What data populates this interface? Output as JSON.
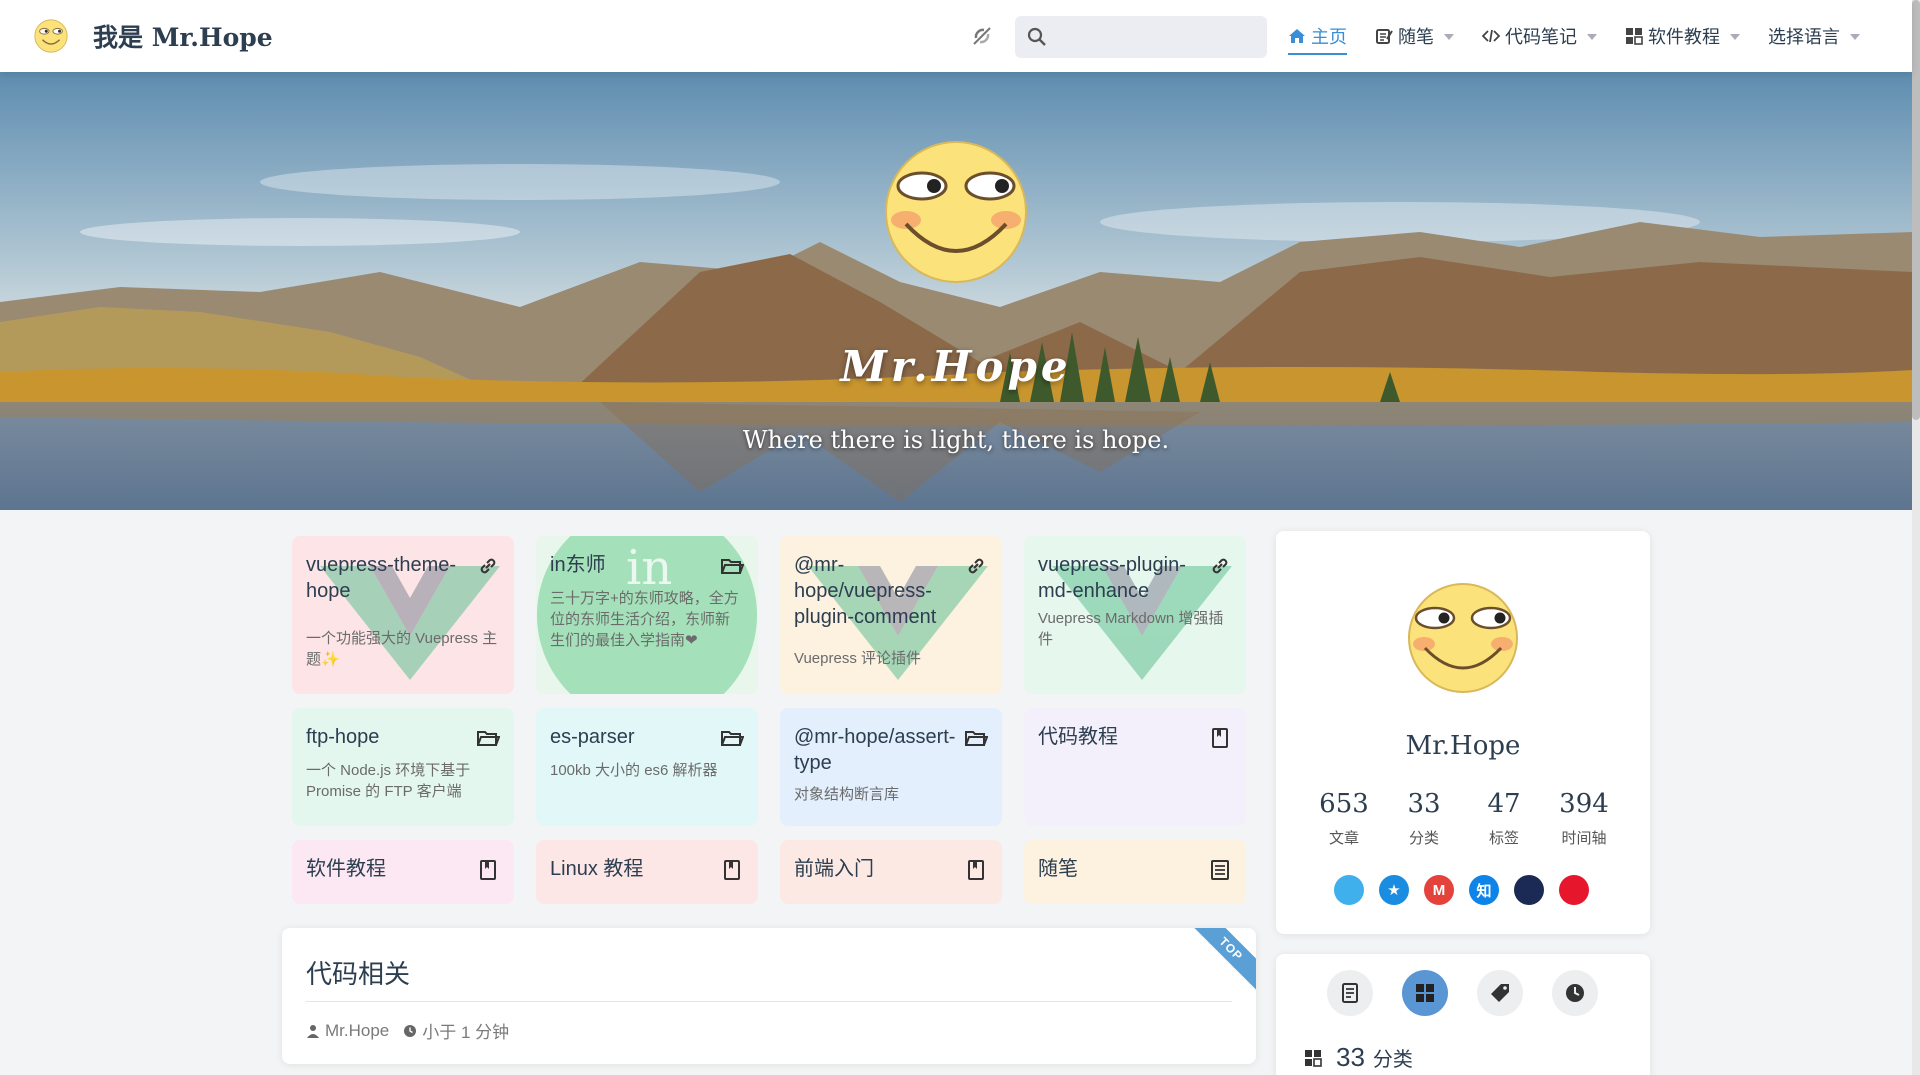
{
  "navbar": {
    "title": "我是 Mr.Hope",
    "search": {
      "value": "",
      "placeholder": ""
    },
    "items": [
      {
        "label": "主页",
        "icon": "home-icon",
        "active": true,
        "dropdown": false
      },
      {
        "label": "随笔",
        "icon": "notes-icon",
        "active": false,
        "dropdown": true
      },
      {
        "label": "代码笔记",
        "icon": "code-icon",
        "active": false,
        "dropdown": true
      },
      {
        "label": "软件教程",
        "icon": "grid-icon",
        "active": false,
        "dropdown": true
      },
      {
        "label": "选择语言",
        "icon": "",
        "active": false,
        "dropdown": true
      }
    ]
  },
  "hero": {
    "title": "Mr.Hope",
    "tagline": "Where there is light, there is hope."
  },
  "projects": [
    {
      "title": "vuepress-theme-hope",
      "desc": "一个功能强大的 Vuepress 主题✨",
      "icon": "link-icon",
      "bg": "#fde4e6",
      "vue": true
    },
    {
      "title": "in东师",
      "desc": "三十万字+的东师攻略，全方位的东师生活介绍，东师新生们的最佳入学指南❤",
      "icon": "folder-icon",
      "bg": "#e8f6ec",
      "indong": true
    },
    {
      "title": "@mr-hope/vuepress-plugin-comment",
      "desc": "Vuepress 评论插件",
      "icon": "link-icon",
      "bg": "#fdf1e0",
      "vue": true
    },
    {
      "title": "vuepress-plugin-md-enhance",
      "desc": "Vuepress Markdown 增强插件",
      "icon": "link-icon",
      "bg": "#e6f7ed",
      "vue": true
    },
    {
      "title": "ftp-hope",
      "desc": "一个 Node.js 环境下基于 Promise 的 FTP 客户端",
      "icon": "folder-icon",
      "bg": "#e4f7ee"
    },
    {
      "title": "es-parser",
      "desc": "100kb 大小的 es6 解析器",
      "icon": "folder-icon",
      "bg": "#e2f8f8"
    },
    {
      "title": "@mr-hope/assert-type",
      "desc": "对象结构断言库",
      "icon": "folder-icon",
      "bg": "#e3effc"
    },
    {
      "title": "代码教程",
      "desc": "",
      "icon": "book-icon",
      "bg": "#f4f0fb"
    },
    {
      "title": "软件教程",
      "desc": "",
      "icon": "book-icon",
      "bg": "#fbe8f2"
    },
    {
      "title": "Linux 教程",
      "desc": "",
      "icon": "book-icon",
      "bg": "#fde6e6"
    },
    {
      "title": "前端入门",
      "desc": "",
      "icon": "book-icon",
      "bg": "#fde9e4"
    },
    {
      "title": "随笔",
      "desc": "",
      "icon": "article-icon",
      "bg": "#fdf1e0"
    }
  ],
  "article": {
    "title": "代码相关",
    "badge": "TOP",
    "author": "Mr.Hope",
    "reading_time": "小于 1 分钟"
  },
  "profile": {
    "name": "Mr.Hope",
    "stats": [
      {
        "num": "653",
        "label": "文章"
      },
      {
        "num": "33",
        "label": "分类"
      },
      {
        "num": "47",
        "label": "标签"
      },
      {
        "num": "394",
        "label": "时间轴"
      }
    ],
    "socials": [
      {
        "name": "qq-icon",
        "color": "#3fb0ec",
        "glyph": ""
      },
      {
        "name": "qzone-icon",
        "color": "#1a8de0",
        "glyph": "★"
      },
      {
        "name": "gmail-icon",
        "color": "#e4433b",
        "glyph": "M"
      },
      {
        "name": "zhihu-icon",
        "color": "#0e84e9",
        "glyph": "知"
      },
      {
        "name": "steam-icon",
        "color": "#1b2a55",
        "glyph": ""
      },
      {
        "name": "weibo-icon",
        "color": "#e6162d",
        "glyph": ""
      }
    ]
  },
  "blog_info": {
    "count": "33",
    "unit": "分类"
  }
}
